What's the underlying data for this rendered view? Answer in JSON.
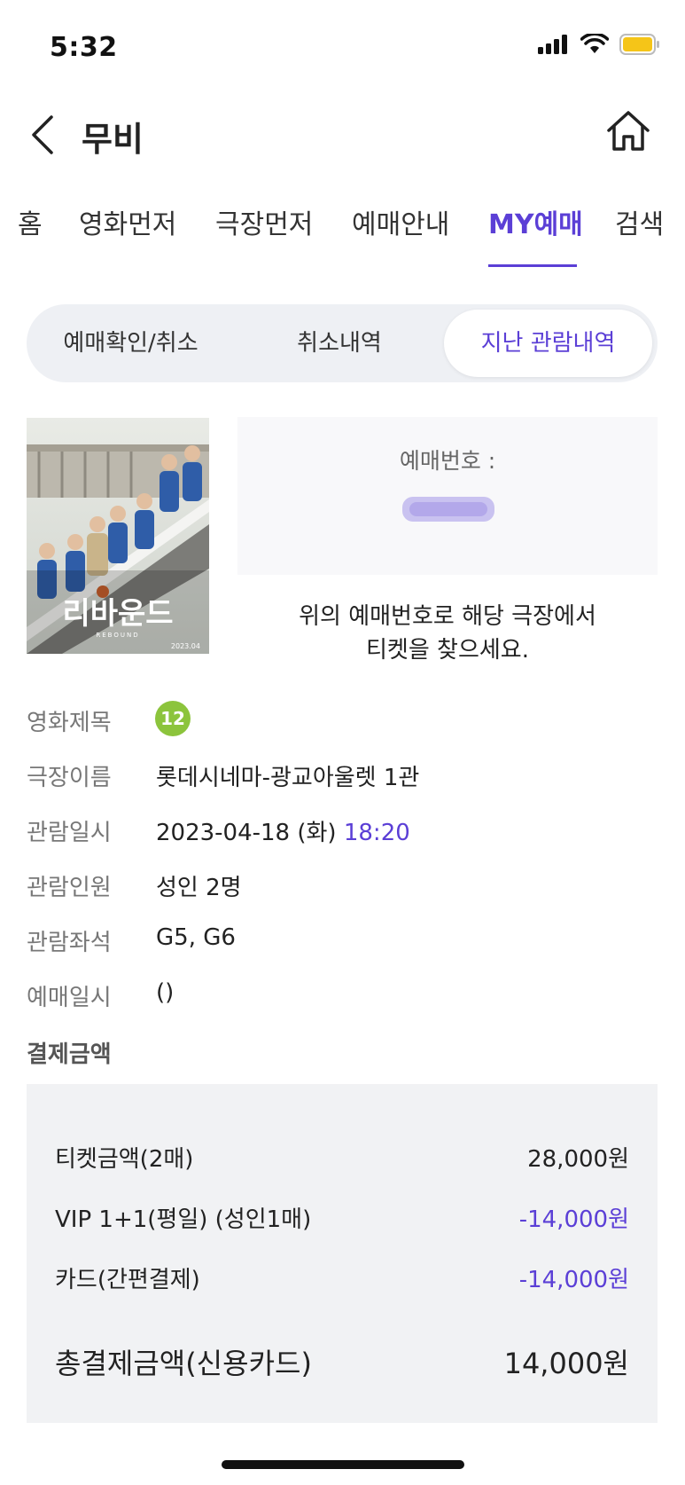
{
  "status_bar": {
    "time": "5:32"
  },
  "header": {
    "title": "무비"
  },
  "nav_tabs": [
    {
      "label": "홈",
      "active": false
    },
    {
      "label": "영화먼저",
      "active": false
    },
    {
      "label": "극장먼저",
      "active": false
    },
    {
      "label": "예매안내",
      "active": false
    },
    {
      "label": "MY예매",
      "active": true
    },
    {
      "label": "검색",
      "active": false
    }
  ],
  "segments": [
    {
      "label": "예매확인/취소",
      "active": false
    },
    {
      "label": "취소내역",
      "active": false
    },
    {
      "label": "지난 관람내역",
      "active": true
    }
  ],
  "poster": {
    "title": "리바운드",
    "subtitle": "REBOUND",
    "date": "2023.04"
  },
  "booking": {
    "label": "예매번호 :",
    "note_line1": "위의 예매번호로 해당 극장에서",
    "note_line2": "티켓을 찾으세요."
  },
  "details": {
    "movie_label": "영화제목",
    "rating": "12",
    "theater_label": "극장이름",
    "theater": "롯데시네마-광교아울렛 1관",
    "datetime_label": "관람일시",
    "date": "2023-04-18 (화)",
    "time": "18:20",
    "people_label": "관람인원",
    "people": "성인 2명",
    "seats_label": "관람좌석",
    "seats": "G5, G6",
    "booked_label": "예매일시",
    "booked": "()"
  },
  "payment": {
    "heading": "결제금액",
    "rows": [
      {
        "label": "티켓금액(2매)",
        "amount": "28,000원"
      },
      {
        "label": "VIP 1+1(평일) (성인1매)",
        "amount": "-14,000원"
      },
      {
        "label": "카드(간편결제)",
        "amount": "-14,000원"
      }
    ],
    "total_label": "총결제금액(신용카드)",
    "total": "14,000원"
  },
  "colors": {
    "accent": "#5b3fd6",
    "rating_badge": "#8cc43c",
    "battery": "#f5c518"
  }
}
